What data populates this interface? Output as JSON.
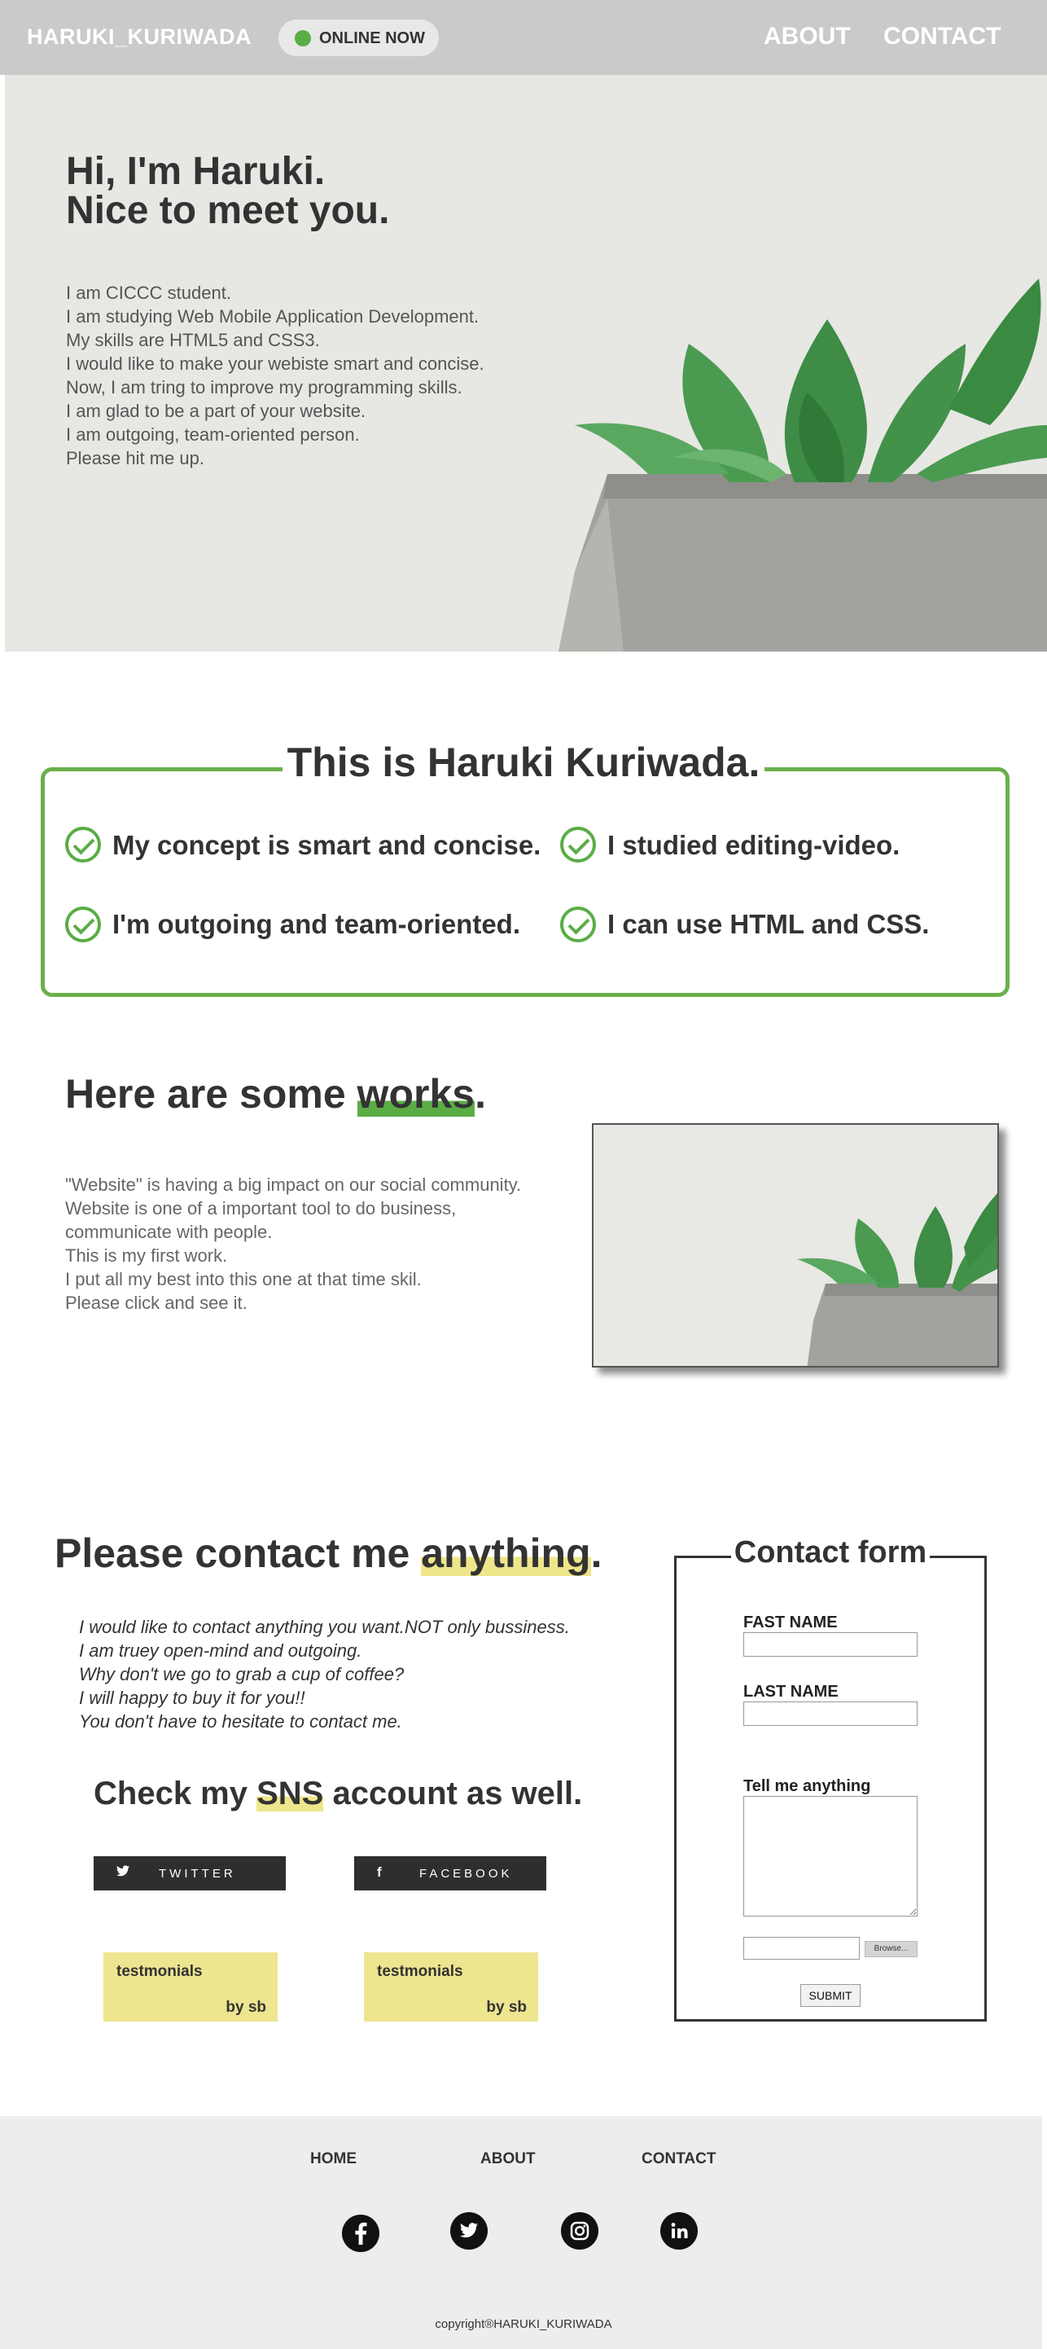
{
  "header": {
    "brand": "HARUKI_KURIWADA",
    "status": "ONLINE NOW",
    "nav": [
      "ABOUT",
      "CONTACT"
    ]
  },
  "hero": {
    "heading_line1": "Hi, I'm Haruki.",
    "heading_line2": "Nice to meet you.",
    "bio": [
      "I am CICCC student.",
      "I am studying Web Mobile Application Development.",
      "My skills are HTML5 and CSS3.",
      "I would like to make your webiste smart and concise.",
      "Now, I am tring to improve my programming skills.",
      "I am glad to be a part of your website.",
      "I am outgoing, team-oriented person.",
      "Please hit me up."
    ]
  },
  "about": {
    "title": "This is Haruki Kuriwada.",
    "points": [
      "My concept is smart and concise.",
      "I studied editing-video.",
      "I'm outgoing and team-oriented.",
      "I can use HTML and CSS."
    ]
  },
  "works": {
    "title_before": "Here are some ",
    "title_highlight": "works",
    "title_after": ".",
    "desc": [
      "\"Website\" is having a big impact on our social community.",
      "Website is one of a important tool to do business,",
      "communicate with people.",
      "This is my first work.",
      "I put all my best into this one at that time skil.",
      "Please click and see it."
    ]
  },
  "contact": {
    "title_before": "Please contact me ",
    "title_highlight": "anything",
    "title_after": ".",
    "desc": [
      "I would like to contact anything you want.NOT only bussiness.",
      "I am truey open-mind and outgoing.",
      "Why don't we go to grab a cup of coffee?",
      "I will happy to buy it for you!!",
      "You don't have to hesitate to contact me."
    ],
    "sns_before": "Check my ",
    "sns_highlight": "SNS",
    "sns_after": " account as well.",
    "buttons": [
      {
        "label": "TWITTER",
        "icon": "twitter-icon"
      },
      {
        "label": "FACEBOOK",
        "icon": "facebook-icon"
      }
    ],
    "testimonials": [
      {
        "title": "testmonials",
        "by": "by sb"
      },
      {
        "title": "testmonials",
        "by": "by sb"
      }
    ]
  },
  "form": {
    "title": "Contact form",
    "first_name_label": "FAST NAME",
    "last_name_label": "LAST NAME",
    "message_label": "Tell me anything",
    "browse_label": "Browse...",
    "submit_label": "SUBMIT"
  },
  "footer": {
    "nav": [
      "HOME",
      "ABOUT",
      "CONTACT"
    ],
    "social": [
      "facebook-icon",
      "twitter-icon",
      "instagram-icon",
      "linkedin-icon"
    ],
    "copyright": "copyright®HARUKI_KURIWADA"
  },
  "colors": {
    "accent_green": "#5aad45",
    "highlight_yellow": "#efe68b",
    "header_bg": "#cacaca",
    "footer_bg": "#ededed"
  }
}
